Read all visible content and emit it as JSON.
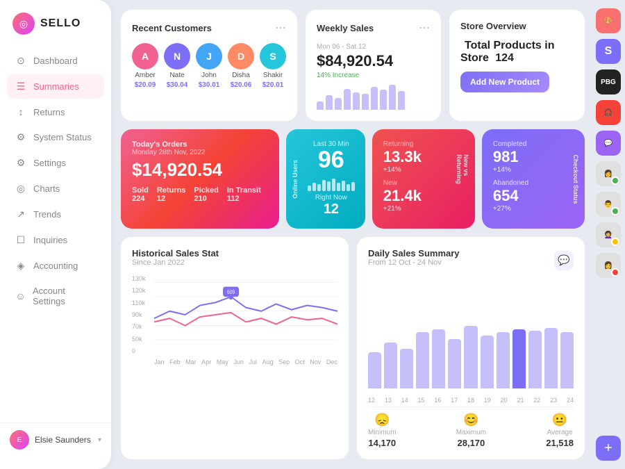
{
  "app": {
    "name": "SELLO"
  },
  "sidebar": {
    "items": [
      {
        "id": "dashboard",
        "label": "Dashboard",
        "icon": "⊙",
        "active": false
      },
      {
        "id": "summaries",
        "label": "Summaries",
        "icon": "☰",
        "active": true
      },
      {
        "id": "returns",
        "label": "Returns",
        "icon": "↕",
        "active": false
      },
      {
        "id": "system-status",
        "label": "System Status",
        "icon": "⚙",
        "active": false
      },
      {
        "id": "settings",
        "label": "Settings",
        "icon": "⚙",
        "active": false
      },
      {
        "id": "charts",
        "label": "Charts",
        "icon": "◎",
        "active": false
      },
      {
        "id": "trends",
        "label": "Trends",
        "icon": "↗",
        "active": false
      },
      {
        "id": "inquiries",
        "label": "Inquiries",
        "icon": "☐",
        "active": false
      },
      {
        "id": "accounting",
        "label": "Accounting",
        "icon": "◈",
        "active": false
      },
      {
        "id": "account-settings",
        "label": "Account Settings",
        "icon": "☺",
        "active": false
      }
    ],
    "user": {
      "name": "Elsie Saunders"
    }
  },
  "recent_customers": {
    "title": "Recent Customers",
    "customers": [
      {
        "name": "Amber",
        "amount": "$20.09",
        "color": "#f06292",
        "initials": "A"
      },
      {
        "name": "Nate",
        "amount": "$30.04",
        "color": "#7c6ef7",
        "initials": "N"
      },
      {
        "name": "John",
        "amount": "$30.01",
        "color": "#42a5f5",
        "initials": "J"
      },
      {
        "name": "Disha",
        "amount": "$20.06",
        "color": "#ff8a65",
        "initials": "D"
      },
      {
        "name": "Shakir",
        "amount": "$20.01",
        "color": "#26c6da",
        "initials": "S"
      }
    ]
  },
  "weekly_sales": {
    "title": "Weekly Sales",
    "date_range": "Mon 06 - Sat 12",
    "amount": "$84,920.54",
    "increase_label": "14% Increase",
    "bars": [
      20,
      35,
      28,
      50,
      42,
      38,
      55,
      48,
      60,
      45
    ]
  },
  "store_overview": {
    "title": "Store Overview",
    "total_products_label": "Total Products in Store",
    "total_products_value": "124",
    "add_button": "Add New Product"
  },
  "stat_cards": {
    "orders": {
      "label": "Today's Orders",
      "date": "Monday 28th Nov, 2022",
      "amount": "$14,920.54",
      "sold_label": "Sold",
      "sold_val": "224",
      "returns_label": "Returns",
      "returns_val": "12",
      "picked_label": "Picked",
      "picked_val": "210",
      "transit_label": "In Transit",
      "transit_val": "112"
    },
    "online": {
      "side_label": "Online Users",
      "returning_label": "Last 30 Min",
      "returning_val": "96",
      "now_label": "Right Now",
      "now_val": "12"
    },
    "new_vs_ret": {
      "side_label": "New vs Returning",
      "returning_label": "Returning",
      "returning_val": "13.3k",
      "returning_change": "+14%",
      "new_label": "New",
      "new_val": "21.4k",
      "new_change": "+21%"
    },
    "checkout": {
      "side_label": "Checkout Status",
      "completed_label": "Completed",
      "completed_val": "981",
      "completed_change": "+14%",
      "abandoned_label": "Abandoned",
      "abandoned_val": "654",
      "abandoned_change": "+27%"
    }
  },
  "historical_sales": {
    "title": "Historical Sales Stat",
    "subtitle": "Since Jan 2022",
    "y_labels": [
      "130k",
      "120k",
      "110k",
      "90k",
      "70k",
      "50k",
      "0"
    ],
    "x_labels": [
      "Jan",
      "Feb",
      "Mar",
      "Apr",
      "May",
      "Jun",
      "Jul",
      "Aug",
      "Sep",
      "Oct",
      "Nov",
      "Dec"
    ]
  },
  "daily_sales": {
    "title": "Daily Sales Summary",
    "subtitle": "From 12 Oct - 24 Nov",
    "x_labels": [
      "12",
      "13",
      "14",
      "15",
      "16",
      "17",
      "18",
      "19",
      "20",
      "21",
      "22",
      "23",
      "24"
    ],
    "bars": [
      55,
      70,
      60,
      85,
      90,
      75,
      95,
      80,
      85,
      90,
      88,
      92,
      85
    ],
    "highlight_idx": 9,
    "min_label": "Minimum",
    "min_val": "14,170",
    "max_label": "Maximum",
    "max_val": "28,170",
    "avg_label": "Average",
    "avg_val": "21,518"
  },
  "right_panel": {
    "avatars": [
      {
        "bg": "#f97070",
        "text": "🎨",
        "dot": null
      },
      {
        "bg": "#7c6ef7",
        "text": "S",
        "dot": null
      },
      {
        "bg": "#222",
        "text": "PBG",
        "dot": null
      },
      {
        "bg": "#f44336",
        "text": "🎧",
        "dot": null
      },
      {
        "bg": "#9c64f5",
        "text": "💬",
        "dot": null
      },
      {
        "bg": "#e0e0e0",
        "text": "👩",
        "dot": "green"
      },
      {
        "bg": "#e0e0e0",
        "text": "👨",
        "dot": "green"
      },
      {
        "bg": "#e0e0e0",
        "text": "👩‍🦱",
        "dot": "yellow"
      },
      {
        "bg": "#e0e0e0",
        "text": "👩",
        "dot": "red"
      }
    ],
    "add_label": "+"
  }
}
